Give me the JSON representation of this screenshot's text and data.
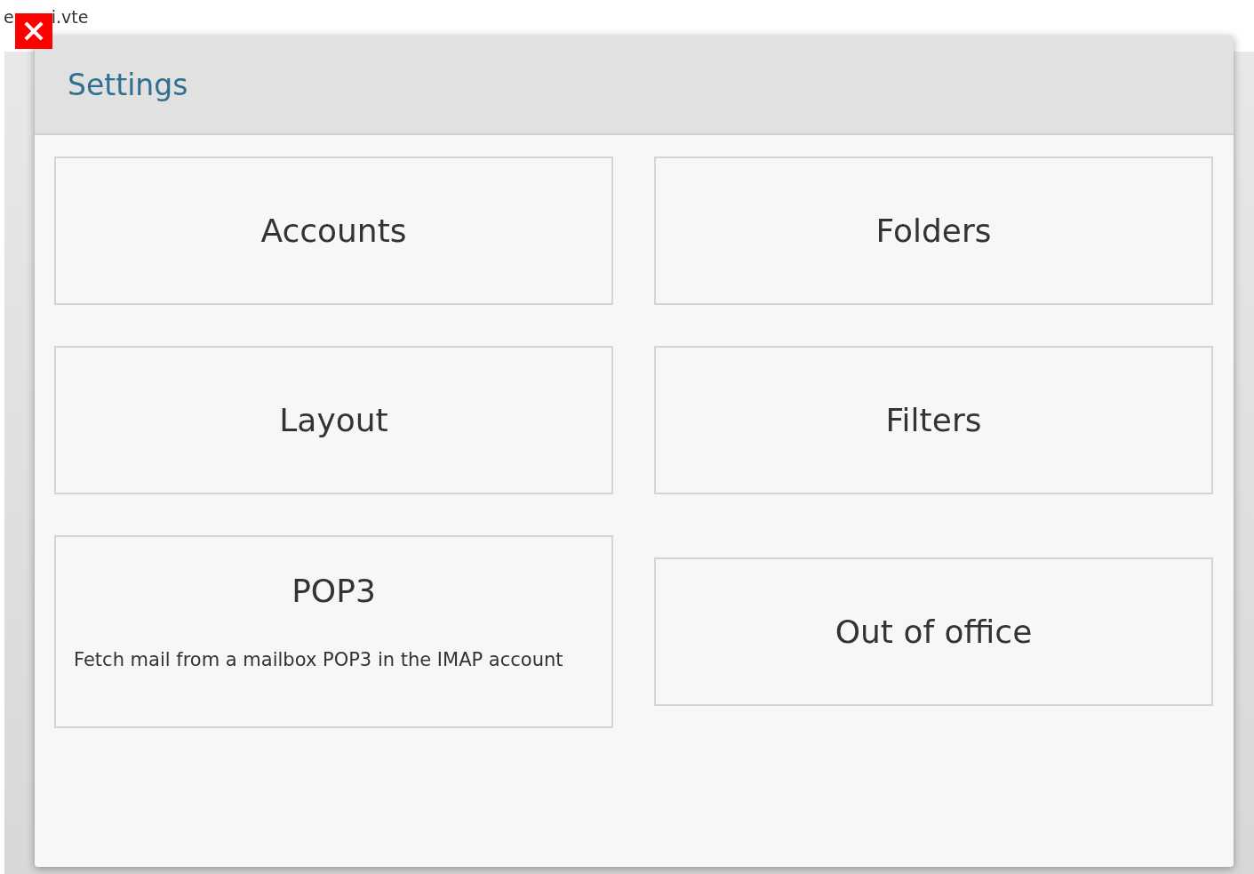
{
  "background_text": [
    "e",
    "i.vte"
  ],
  "dialog": {
    "title": "Settings",
    "tiles": [
      {
        "title": "Accounts"
      },
      {
        "title": "Folders"
      },
      {
        "title": "Layout"
      },
      {
        "title": "Filters"
      },
      {
        "title": "POP3",
        "description": "Fetch mail from a mailbox POP3 in the IMAP account"
      },
      {
        "title": "Out of office"
      }
    ]
  }
}
